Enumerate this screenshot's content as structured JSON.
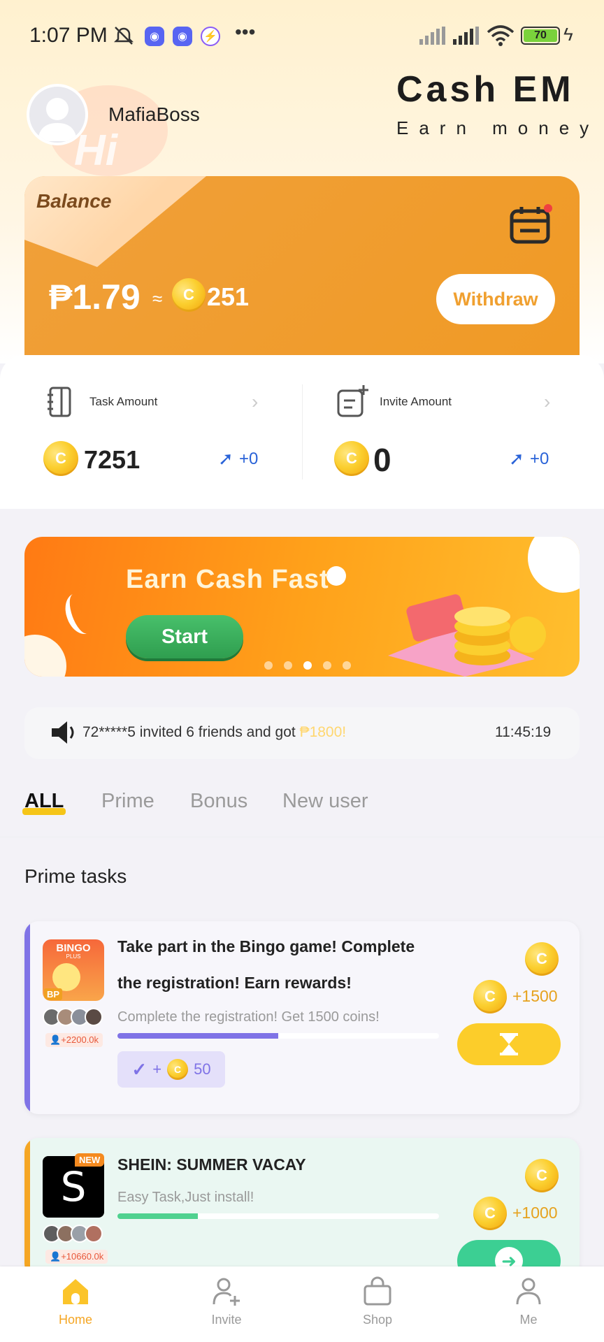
{
  "status_bar": {
    "time": "1:07 PM",
    "battery": "70"
  },
  "header": {
    "username": "MafiaBoss",
    "avatar_text": "Hi",
    "brand": "Cash EM",
    "brand_sub": "Earn money"
  },
  "balance": {
    "label": "Balance",
    "amount": "₱1.79",
    "approx": "≈",
    "coins": "251",
    "withdraw_label": "Withdraw"
  },
  "amounts": {
    "task": {
      "label": "Task Amount",
      "value": "7251",
      "increase": "+0"
    },
    "invite": {
      "label": "Invite Amount",
      "value": "0",
      "increase": "+0"
    }
  },
  "banner": {
    "title": "Earn Cash Fast",
    "button_label": "Start",
    "dots": 5,
    "active_dot": 3
  },
  "notice": {
    "text": "72*****5 invited 6 friends and got ",
    "reward": "₱1800!",
    "time": "11:45:19"
  },
  "tabs": [
    "ALL",
    "Prime",
    "Bonus",
    "New user"
  ],
  "section_title": "Prime tasks",
  "tasks": [
    {
      "icon_label": "BINGO",
      "icon_sub": "PLUS",
      "icon_badge": "BP",
      "title_line1": "Take part in the Bingo game! Complete",
      "title_line2": "the registration! Earn rewards!",
      "subtitle": "Complete the registration! Get 1500 coins!",
      "participants": "+2200.0k",
      "progress": 0.5,
      "bonus": "50",
      "bonus_prefix": "+",
      "reward": "+1500",
      "accent": "#7f73e6"
    },
    {
      "icon_label": "S",
      "icon_badge": "NEW",
      "title_line1": "SHEIN: SUMMER VACAY",
      "subtitle": "Easy Task,Just install!",
      "participants": "+10660.0k",
      "progress": 0.25,
      "reward": "+1000",
      "accent": "#f5a623"
    }
  ],
  "nav": [
    "Home",
    "Invite",
    "Shop",
    "Me"
  ],
  "colors": {
    "accent": "#f5a623",
    "balance_card": "#f09a25",
    "coin": "#fbcf2f",
    "task_progress_1": "#7f73e6",
    "task_progress_2": "#4fd18f"
  }
}
